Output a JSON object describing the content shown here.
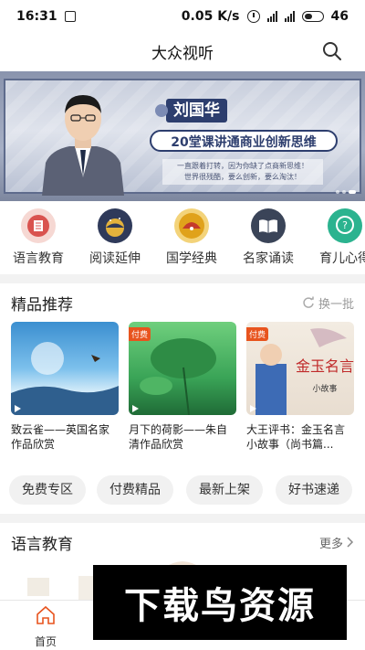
{
  "status_bar": {
    "time": "16:31",
    "speed": "0.05 K/s",
    "battery": "46"
  },
  "header": {
    "title": "大众视听"
  },
  "banner": {
    "name": "刘国华",
    "subtitle": "20堂课讲通商业创新思维",
    "desc_line1": "一直跟着打转，因为你缺了点商新思维！",
    "desc_line2": "世界很残酷，要么创新，要么淘汰！"
  },
  "categories": [
    {
      "label": "语言教育",
      "icon": "book-icon",
      "color": "#d9534f"
    },
    {
      "label": "阅读延伸",
      "icon": "planet-icon",
      "color": "#2f3a5a"
    },
    {
      "label": "国学经典",
      "icon": "fan-icon",
      "color": "#e0a21b"
    },
    {
      "label": "名家诵读",
      "icon": "open-book-icon",
      "color": "#3a4458"
    },
    {
      "label": "育儿心得",
      "icon": "question-bubble-icon",
      "color": "#2bb38f"
    }
  ],
  "featured": {
    "title": "精品推荐",
    "refresh_label": "换一批",
    "items": [
      {
        "title": "致云雀——英国名家作品欣赏",
        "paid": ""
      },
      {
        "title": "月下的荷影——朱自清作品欣赏",
        "paid": "付费"
      },
      {
        "title": "大王评书：金玉名言小故事（尚书篇...",
        "paid": "付费"
      }
    ]
  },
  "chips": [
    "免费专区",
    "付费精品",
    "最新上架",
    "好书速递"
  ],
  "language_section": {
    "title": "语言教育",
    "more": "更多"
  },
  "watermark": "下载鸟资源",
  "bottom_nav": [
    {
      "label": "首页",
      "active": true
    },
    {
      "label": ""
    },
    {
      "label": ""
    },
    {
      "label": ""
    },
    {
      "label": ""
    }
  ]
}
